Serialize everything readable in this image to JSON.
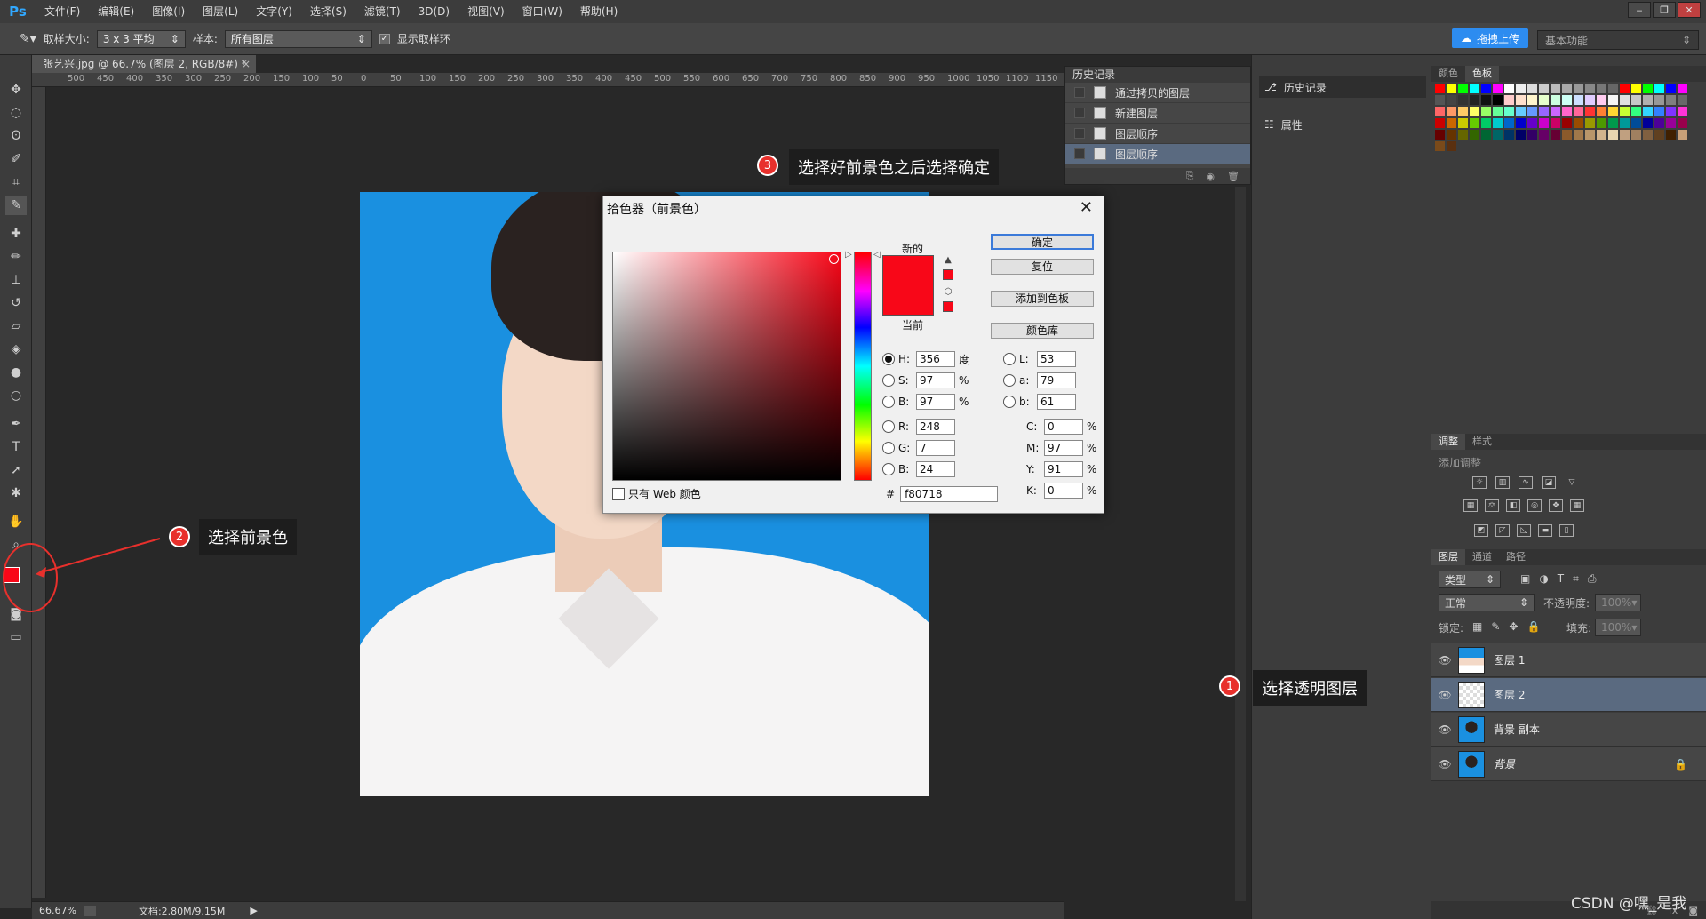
{
  "app": {
    "logo": "Ps"
  },
  "menu": [
    "文件(F)",
    "编辑(E)",
    "图像(I)",
    "图层(L)",
    "文字(Y)",
    "选择(S)",
    "滤镜(T)",
    "3D(D)",
    "视图(V)",
    "窗口(W)",
    "帮助(H)"
  ],
  "window_controls": [
    "‒",
    "❐",
    "✕"
  ],
  "options_bar": {
    "sample_size_label": "取样大小:",
    "sample_size_value": "3 x 3 平均",
    "sample_label": "样本:",
    "sample_value": "所有图层",
    "show_ring_label": "显示取样环",
    "upload_label": "拖拽上传",
    "workspace_value": "基本功能"
  },
  "document": {
    "tab_title": "张艺兴.jpg @ 66.7% (图层 2, RGB/8#) *",
    "close": "×",
    "ruler_ticks": [
      "500",
      "450",
      "400",
      "350",
      "300",
      "250",
      "200",
      "150",
      "100",
      "50",
      "0",
      "50",
      "100",
      "150",
      "200",
      "250",
      "300",
      "350",
      "400",
      "450",
      "500",
      "550",
      "600",
      "650",
      "700",
      "750",
      "800",
      "850",
      "900",
      "950",
      "1000",
      "1050",
      "1100",
      "1150"
    ]
  },
  "status": {
    "zoom": "66.67%",
    "doc_info": "文档:2.80M/9.15M"
  },
  "history_panel": {
    "title": "历史记录",
    "items": [
      "通过拷贝的图层",
      "新建图层",
      "图层顺序",
      "图层顺序"
    ],
    "active_index": 3
  },
  "dock_mid": {
    "history_label": "历史记录",
    "properties_label": "属性"
  },
  "swatches_panel": {
    "tabs": [
      "颜色",
      "色板"
    ],
    "active": "色板"
  },
  "adjustments_panel": {
    "tabs": [
      "调整",
      "样式"
    ],
    "subtitle": "添加调整"
  },
  "layers_panel": {
    "tabs": [
      "图层",
      "通道",
      "路径"
    ],
    "filter_value": "类型",
    "blend_mode": "正常",
    "opacity_label": "不透明度:",
    "opacity_value": "100%",
    "lock_label": "锁定:",
    "fill_label": "填充:",
    "fill_value": "100%",
    "layers": [
      {
        "name": "图层 1",
        "thumb": "portrait"
      },
      {
        "name": "图层 2",
        "thumb": "transparent",
        "active": true
      },
      {
        "name": "背景 副本",
        "thumb": "portrait2"
      },
      {
        "name": "背景",
        "thumb": "portrait2",
        "locked": true
      }
    ]
  },
  "color_picker": {
    "title": "拾色器（前景色）",
    "close": "✕",
    "new_label": "新的",
    "current_label": "当前",
    "color_hex": "#f80718",
    "buttons": {
      "ok": "确定",
      "reset": "复位",
      "add_swatch": "添加到色板",
      "libraries": "颜色库"
    },
    "hsb": {
      "H": "356",
      "S": "97",
      "B": "97",
      "H_unit": "度",
      "S_unit": "%",
      "B_unit": "%"
    },
    "rgb": {
      "R": "248",
      "G": "7",
      "B": "24"
    },
    "lab": {
      "L": "53",
      "a": "79",
      "b": "61"
    },
    "cmyk": {
      "C": "0",
      "M": "97",
      "Y": "91",
      "K": "0"
    },
    "web_only_label": "只有 Web 颜色",
    "hex": "f80718",
    "hash": "#"
  },
  "annotations": [
    {
      "num": "1",
      "text": "选择透明图层"
    },
    {
      "num": "2",
      "text": "选择前景色"
    },
    {
      "num": "3",
      "text": "选择好前景色之后选择确定"
    }
  ],
  "watermark": "CSDN @嘿_是我",
  "colors": {
    "foreground": "#f80718",
    "photo_bg": "#1a90e0",
    "annotation": "#e8302c"
  }
}
